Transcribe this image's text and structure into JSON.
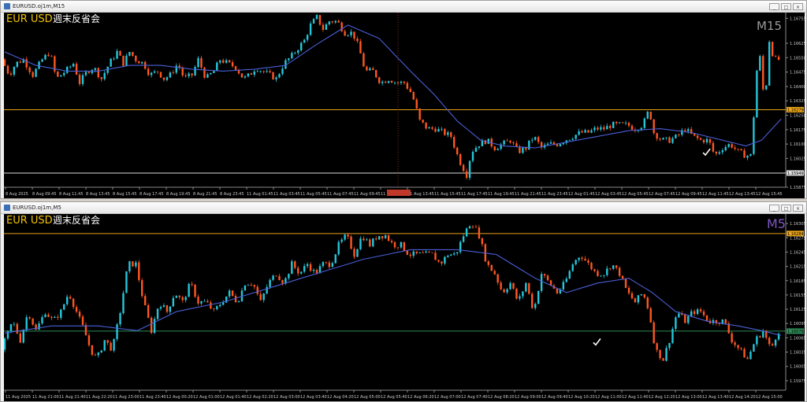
{
  "windows": [
    {
      "title": "EURUSD.oj1m,M15",
      "symbol": "EUR USD",
      "heading": "週末反省会",
      "timeframe": "M15",
      "buttons": [
        "_",
        "□",
        "×"
      ]
    },
    {
      "title": "EURUSD.oj1m,M5",
      "symbol": "EUR USD",
      "heading": "週末反省会",
      "timeframe": "M5",
      "buttons": [
        "_",
        "□",
        "×"
      ]
    }
  ],
  "colors": {
    "bull": "#26c6da",
    "bear": "#ff5722",
    "ma": "#4a5fd8",
    "symbol": "#f5c400",
    "timeframe_m15": "#9a9a9a",
    "timeframe_m5": "#7e57c2",
    "hline_orange": "#e8a317",
    "hline_white": "#dddddd",
    "hline_green": "#2e8b57"
  },
  "chart_data": [
    {
      "type": "candlestick",
      "timeframe": "M15",
      "ylim": [
        1.15875,
        1.16785
      ],
      "y_ticks": [
        1.16755,
        1.16625,
        1.1655,
        1.16475,
        1.164,
        1.16325,
        1.1625,
        1.16175,
        1.161,
        1.16025,
        1.1595,
        1.15875
      ],
      "x_ticks": [
        "8 Aug 2025",
        "8 Aug 09:45",
        "8 Aug 11:45",
        "8 Aug 13:45",
        "8 Aug 15:45",
        "8 Aug 17:45",
        "8 Aug 19:45",
        "8 Aug 21:45",
        "8 Aug 23:45",
        "11 Aug 01:45",
        "11 Aug 03:45",
        "11 Aug 05:45",
        "11 Aug 07:45",
        "11 Aug 09:45",
        "11 Aug 11:45",
        "11 Aug 13:45",
        "11 Aug 15:45",
        "11 Aug 17:45",
        "11 Aug 19:45",
        "11 Aug 21:45",
        "11 Aug 23:45",
        "12 Aug 01:45",
        "12 Aug 03:45",
        "12 Aug 05:45",
        "12 Aug 07:45",
        "12 Aug 09:45",
        "12 Aug 11:45",
        "12 Aug 13:45",
        "12 Aug 15:45"
      ],
      "hlines": [
        {
          "value": 1.16279,
          "label": "1.16279",
          "color": "orange"
        },
        {
          "value": 1.15949,
          "label": "1.15949",
          "color": "white"
        }
      ],
      "checkmark": {
        "x_index": 243,
        "value": 1.16055
      },
      "crosshair_x_index": 140,
      "path": [
        [
          0,
          1.1654
        ],
        [
          10,
          1.1646
        ],
        [
          18,
          1.1652
        ],
        [
          28,
          1.1654
        ],
        [
          40,
          1.1646
        ],
        [
          52,
          1.1654
        ],
        [
          62,
          1.1658
        ],
        [
          70,
          1.1644
        ],
        [
          82,
          1.1648
        ],
        [
          92,
          1.1652
        ],
        [
          100,
          1.1642
        ],
        [
          110,
          1.1648
        ],
        [
          118,
          1.165
        ],
        [
          128,
          1.1644
        ],
        [
          138,
          1.1652
        ],
        [
          148,
          1.1658
        ],
        [
          156,
          1.1652
        ],
        [
          164,
          1.1658
        ],
        [
          172,
          1.1654
        ],
        [
          182,
          1.1652
        ],
        [
          190,
          1.1646
        ],
        [
          200,
          1.1648
        ],
        [
          208,
          1.1644
        ],
        [
          216,
          1.1646
        ],
        [
          226,
          1.1652
        ],
        [
          234,
          1.1644
        ],
        [
          244,
          1.1646
        ],
        [
          252,
          1.1654
        ],
        [
          262,
          1.1644
        ],
        [
          272,
          1.1648
        ],
        [
          280,
          1.1654
        ],
        [
          290,
          1.1652
        ],
        [
          300,
          1.165
        ],
        [
          310,
          1.1644
        ],
        [
          318,
          1.1646
        ],
        [
          326,
          1.165
        ],
        [
          334,
          1.1648
        ],
        [
          344,
          1.1646
        ],
        [
          352,
          1.1644
        ],
        [
          362,
          1.1652
        ],
        [
          372,
          1.1656
        ],
        [
          380,
          1.166
        ],
        [
          388,
          1.1664
        ],
        [
          396,
          1.1672
        ],
        [
          404,
          1.1676
        ],
        [
          412,
          1.167
        ],
        [
          420,
          1.1674
        ],
        [
          430,
          1.1674
        ],
        [
          440,
          1.1668
        ],
        [
          450,
          1.1668
        ],
        [
          458,
          1.166
        ],
        [
          466,
          1.1648
        ],
        [
          476,
          1.1648
        ],
        [
          486,
          1.1642
        ],
        [
          496,
          1.1644
        ],
        [
          506,
          1.1642
        ],
        [
          516,
          1.1642
        ],
        [
          526,
          1.1636
        ],
        [
          536,
          1.1622
        ],
        [
          546,
          1.1618
        ],
        [
          556,
          1.1618
        ],
        [
          566,
          1.1616
        ],
        [
          576,
          1.1614
        ],
        [
          586,
          1.1602
        ],
        [
          596,
          1.1594
        ],
        [
          602,
          1.1606
        ],
        [
          612,
          1.161
        ],
        [
          622,
          1.1612
        ],
        [
          632,
          1.1608
        ],
        [
          642,
          1.161
        ],
        [
          652,
          1.1612
        ],
        [
          662,
          1.1606
        ],
        [
          672,
          1.1608
        ],
        [
          682,
          1.1614
        ],
        [
          692,
          1.1608
        ],
        [
          702,
          1.161
        ],
        [
          712,
          1.161
        ],
        [
          722,
          1.1612
        ],
        [
          732,
          1.1614
        ],
        [
          742,
          1.1616
        ],
        [
          752,
          1.1616
        ],
        [
          762,
          1.1618
        ],
        [
          772,
          1.1618
        ],
        [
          782,
          1.162
        ],
        [
          792,
          1.162
        ],
        [
          802,
          1.162
        ],
        [
          812,
          1.1618
        ],
        [
          822,
          1.162
        ],
        [
          830,
          1.1628
        ],
        [
          836,
          1.1616
        ],
        [
          846,
          1.1612
        ],
        [
          856,
          1.1612
        ],
        [
          866,
          1.1614
        ],
        [
          876,
          1.1618
        ],
        [
          886,
          1.1614
        ],
        [
          896,
          1.1612
        ],
        [
          906,
          1.1612
        ],
        [
          914,
          1.1604
        ],
        [
          924,
          1.1608
        ],
        [
          934,
          1.161
        ],
        [
          944,
          1.1606
        ],
        [
          954,
          1.1604
        ],
        [
          962,
          1.1604
        ],
        [
          966,
          1.1645
        ],
        [
          972,
          1.1655
        ],
        [
          978,
          1.163
        ],
        [
          984,
          1.1664
        ],
        [
          990,
          1.1654
        ]
      ],
      "ma_path": [
        [
          0,
          1.1658
        ],
        [
          40,
          1.1651
        ],
        [
          80,
          1.1648
        ],
        [
          120,
          1.1648
        ],
        [
          160,
          1.1651
        ],
        [
          200,
          1.1651
        ],
        [
          240,
          1.1649
        ],
        [
          280,
          1.1648
        ],
        [
          320,
          1.1649
        ],
        [
          360,
          1.1651
        ],
        [
          400,
          1.1662
        ],
        [
          440,
          1.1672
        ],
        [
          480,
          1.1665
        ],
        [
          520,
          1.1648
        ],
        [
          550,
          1.1636
        ],
        [
          580,
          1.1622
        ],
        [
          610,
          1.1612
        ],
        [
          640,
          1.1609
        ],
        [
          680,
          1.1608
        ],
        [
          720,
          1.1611
        ],
        [
          760,
          1.1614
        ],
        [
          800,
          1.1617
        ],
        [
          840,
          1.1618
        ],
        [
          880,
          1.1616
        ],
        [
          920,
          1.1612
        ],
        [
          950,
          1.1609
        ],
        [
          970,
          1.1612
        ],
        [
          995,
          1.1623
        ]
      ]
    },
    {
      "type": "candlestick",
      "timeframe": "M5",
      "ylim": [
        1.15955,
        1.16325
      ],
      "y_ticks": [
        1.16305,
        1.16275,
        1.16245,
        1.16215,
        1.16185,
        1.16155,
        1.16125,
        1.16095,
        1.16065,
        1.16035,
        1.16005,
        1.15975
      ],
      "x_ticks": [
        "11 Aug 2025",
        "11 Aug 21:00",
        "11 Aug 21:40",
        "11 Aug 22:20",
        "11 Aug 23:00",
        "11 Aug 23:40",
        "12 Aug 00:20",
        "12 Aug 01:00",
        "12 Aug 01:40",
        "12 Aug 02:20",
        "12 Aug 03:00",
        "12 Aug 03:40",
        "12 Aug 04:20",
        "12 Aug 05:00",
        "12 Aug 05:40",
        "12 Aug 06:20",
        "12 Aug 07:00",
        "12 Aug 07:40",
        "12 Aug 08:20",
        "12 Aug 09:00",
        "12 Aug 09:40",
        "12 Aug 10:20",
        "12 Aug 11:00",
        "12 Aug 11:40",
        "12 Aug 12:20",
        "12 Aug 13:00",
        "12 Aug 13:40",
        "12 Aug 14:20",
        "12 Aug 15:00"
      ],
      "hlines": [
        {
          "value": 1.16284,
          "label": "1.16284",
          "color": "orange"
        },
        {
          "value": 1.16079,
          "label": "1.16079",
          "color": "green"
        }
      ],
      "checkmark": {
        "x_index": 205,
        "value": 1.16055
      },
      "path": [
        [
          0,
          1.1604
        ],
        [
          14,
          1.161
        ],
        [
          24,
          1.1606
        ],
        [
          34,
          1.1612
        ],
        [
          44,
          1.1608
        ],
        [
          56,
          1.1612
        ],
        [
          66,
          1.161
        ],
        [
          76,
          1.1612
        ],
        [
          86,
          1.1616
        ],
        [
          96,
          1.1612
        ],
        [
          106,
          1.1608
        ],
        [
          114,
          1.1604
        ],
        [
          122,
          1.1602
        ],
        [
          132,
          1.1606
        ],
        [
          142,
          1.1604
        ],
        [
          152,
          1.1612
        ],
        [
          162,
          1.1622
        ],
        [
          172,
          1.1622
        ],
        [
          182,
          1.1614
        ],
        [
          192,
          1.1608
        ],
        [
          202,
          1.1614
        ],
        [
          212,
          1.1612
        ],
        [
          222,
          1.1616
        ],
        [
          232,
          1.1614
        ],
        [
          242,
          1.1618
        ],
        [
          252,
          1.1614
        ],
        [
          262,
          1.1614
        ],
        [
          272,
          1.1612
        ],
        [
          282,
          1.1614
        ],
        [
          292,
          1.1616
        ],
        [
          302,
          1.1614
        ],
        [
          312,
          1.1618
        ],
        [
          322,
          1.1618
        ],
        [
          332,
          1.1614
        ],
        [
          342,
          1.1618
        ],
        [
          352,
          1.162
        ],
        [
          362,
          1.1618
        ],
        [
          372,
          1.1622
        ],
        [
          382,
          1.162
        ],
        [
          392,
          1.1622
        ],
        [
          402,
          1.162
        ],
        [
          412,
          1.1622
        ],
        [
          422,
          1.1622
        ],
        [
          432,
          1.1626
        ],
        [
          442,
          1.1628
        ],
        [
          452,
          1.1624
        ],
        [
          462,
          1.1628
        ],
        [
          472,
          1.1626
        ],
        [
          482,
          1.1628
        ],
        [
          492,
          1.1628
        ],
        [
          502,
          1.1626
        ],
        [
          512,
          1.1626
        ],
        [
          522,
          1.1624
        ],
        [
          532,
          1.1624
        ],
        [
          542,
          1.1624
        ],
        [
          552,
          1.1624
        ],
        [
          562,
          1.1622
        ],
        [
          572,
          1.1624
        ],
        [
          582,
          1.1624
        ],
        [
          592,
          1.1628
        ],
        [
          602,
          1.1631
        ],
        [
          612,
          1.1628
        ],
        [
          622,
          1.1622
        ],
        [
          632,
          1.162
        ],
        [
          642,
          1.1616
        ],
        [
          652,
          1.1618
        ],
        [
          662,
          1.1614
        ],
        [
          672,
          1.1618
        ],
        [
          682,
          1.1612
        ],
        [
          692,
          1.162
        ],
        [
          702,
          1.1618
        ],
        [
          712,
          1.1616
        ],
        [
          722,
          1.1618
        ],
        [
          732,
          1.1622
        ],
        [
          742,
          1.1624
        ],
        [
          752,
          1.1622
        ],
        [
          762,
          1.162
        ],
        [
          772,
          1.162
        ],
        [
          782,
          1.1622
        ],
        [
          792,
          1.162
        ],
        [
          802,
          1.1616
        ],
        [
          812,
          1.1614
        ],
        [
          822,
          1.1616
        ],
        [
          830,
          1.1612
        ],
        [
          838,
          1.1604
        ],
        [
          848,
          1.1602
        ],
        [
          856,
          1.1606
        ],
        [
          866,
          1.1612
        ],
        [
          876,
          1.161
        ],
        [
          886,
          1.1612
        ],
        [
          896,
          1.1612
        ],
        [
          906,
          1.161
        ],
        [
          916,
          1.161
        ],
        [
          926,
          1.161
        ],
        [
          936,
          1.1606
        ],
        [
          946,
          1.1604
        ],
        [
          956,
          1.1602
        ],
        [
          966,
          1.1606
        ],
        [
          976,
          1.1608
        ],
        [
          986,
          1.1604
        ],
        [
          995,
          1.1608
        ]
      ],
      "ma_path": [
        [
          0,
          1.16075
        ],
        [
          60,
          1.1609
        ],
        [
          120,
          1.1609
        ],
        [
          170,
          1.1608
        ],
        [
          220,
          1.1612
        ],
        [
          280,
          1.1614
        ],
        [
          340,
          1.1617
        ],
        [
          400,
          1.162
        ],
        [
          460,
          1.1623
        ],
        [
          520,
          1.1625
        ],
        [
          580,
          1.1625
        ],
        [
          630,
          1.1624
        ],
        [
          680,
          1.1619
        ],
        [
          720,
          1.1616
        ],
        [
          760,
          1.1618
        ],
        [
          800,
          1.1619
        ],
        [
          830,
          1.1616
        ],
        [
          860,
          1.1612
        ],
        [
          900,
          1.161
        ],
        [
          940,
          1.1609
        ],
        [
          970,
          1.1608
        ],
        [
          995,
          1.1607
        ]
      ]
    }
  ]
}
